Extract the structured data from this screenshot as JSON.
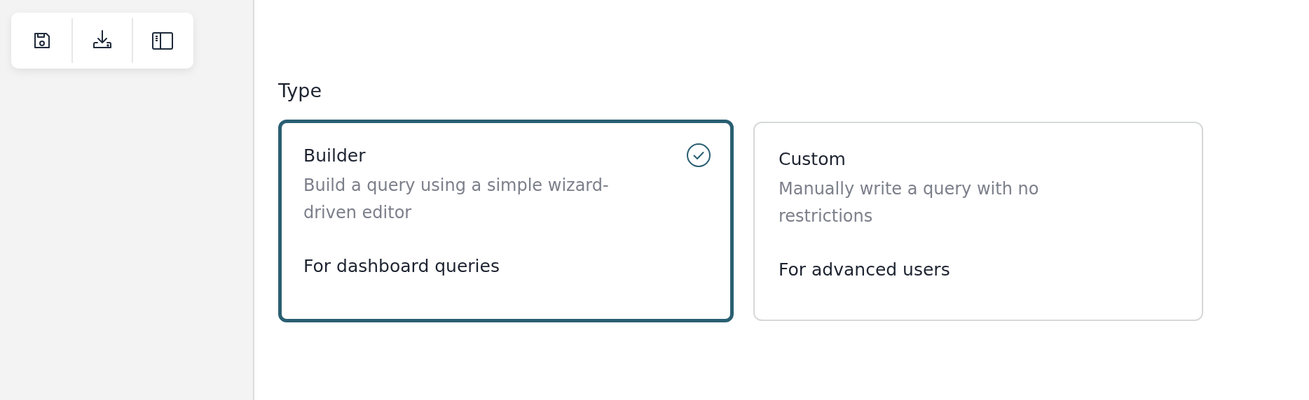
{
  "toolbar": {
    "buttons": [
      {
        "kind": "save"
      },
      {
        "kind": "download"
      },
      {
        "kind": "sidebar"
      }
    ]
  },
  "type_label": "Type",
  "options": [
    {
      "title": "Builder",
      "description": "Build a query using a simple wizard-driven editor",
      "footer": "For dashboard queries",
      "selected": true
    },
    {
      "title": "Custom",
      "description": "Manually write a query with no restrictions",
      "footer": "For advanced users",
      "selected": false
    }
  ]
}
